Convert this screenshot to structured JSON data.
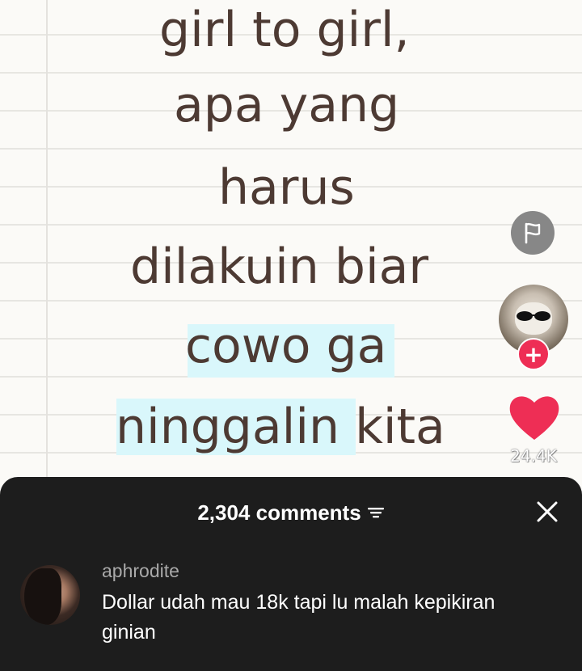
{
  "video": {
    "caption_lines": [
      "girl to girl,",
      "apa yang",
      "harus",
      "dilakuin biar",
      "cowo ga",
      "ninggalin kita"
    ],
    "highlight_words": [
      "cowo ga",
      "ninggalin"
    ],
    "highlight_color": "#d9f7fb",
    "text_color": "#4d3a33",
    "paper_color": "#fbfaf7"
  },
  "sidebar": {
    "report_icon": "flag-icon",
    "creator_avatar": "cat-with-sunglasses",
    "follow_label": "+",
    "like_icon": "heart-icon",
    "like_count": "24.4K",
    "like_color": "#ee2e55"
  },
  "comments": {
    "count_label": "2,304 comments",
    "filter_icon": "filter-icon",
    "close_icon": "close-icon",
    "sheet_color": "#1d1d1d",
    "items": [
      {
        "username": "aphrodite",
        "text": "Dollar udah mau 18k tapi lu malah kepikiran ginian"
      }
    ]
  }
}
